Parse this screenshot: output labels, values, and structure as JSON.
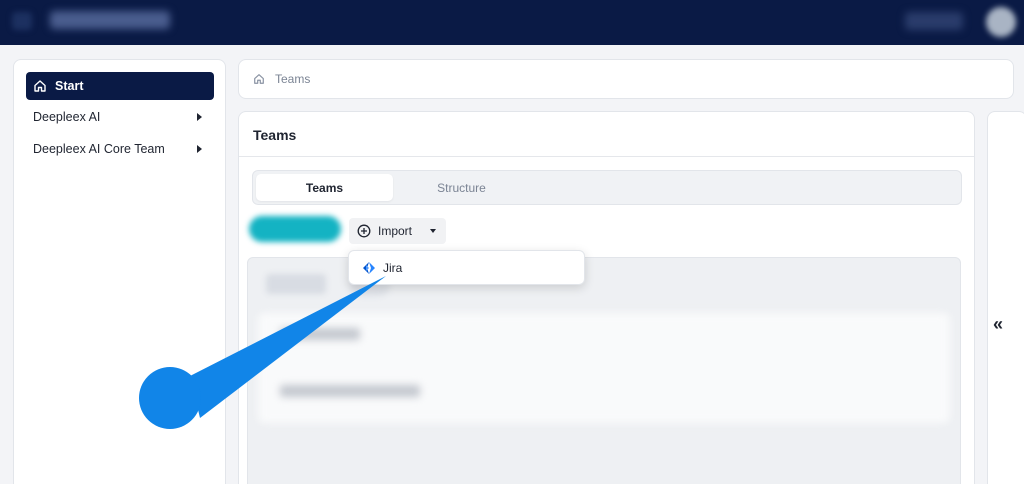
{
  "topbar": {
    "menu_icon": "menu-icon",
    "app_title": "",
    "language": "",
    "avatar": "user-avatar"
  },
  "sidebar": {
    "items": [
      {
        "label": "Start",
        "icon": "home-icon",
        "active": true
      },
      {
        "label": "Deepleex AI",
        "expandable": true
      },
      {
        "label": "Deepleex AI Core Team",
        "expandable": true
      }
    ]
  },
  "breadcrumb": {
    "icon": "home-icon",
    "items": [
      "Teams"
    ]
  },
  "main": {
    "title": "Teams",
    "tabs": [
      {
        "label": "Teams",
        "active": true
      },
      {
        "label": "Structure",
        "active": false
      }
    ],
    "import_button": {
      "label": "Import",
      "icon": "plus-circle-icon"
    },
    "import_menu": [
      {
        "label": "Jira",
        "icon": "jira-icon"
      }
    ]
  },
  "right_panel": {
    "collapse_label": "«"
  },
  "colors": {
    "topbar_bg": "#0a1a45",
    "active_nav_bg": "#0a1a45",
    "accent_teal": "#14b3c3",
    "pointer_blue": "#1185e8",
    "jira_blue": "#2684ff"
  }
}
